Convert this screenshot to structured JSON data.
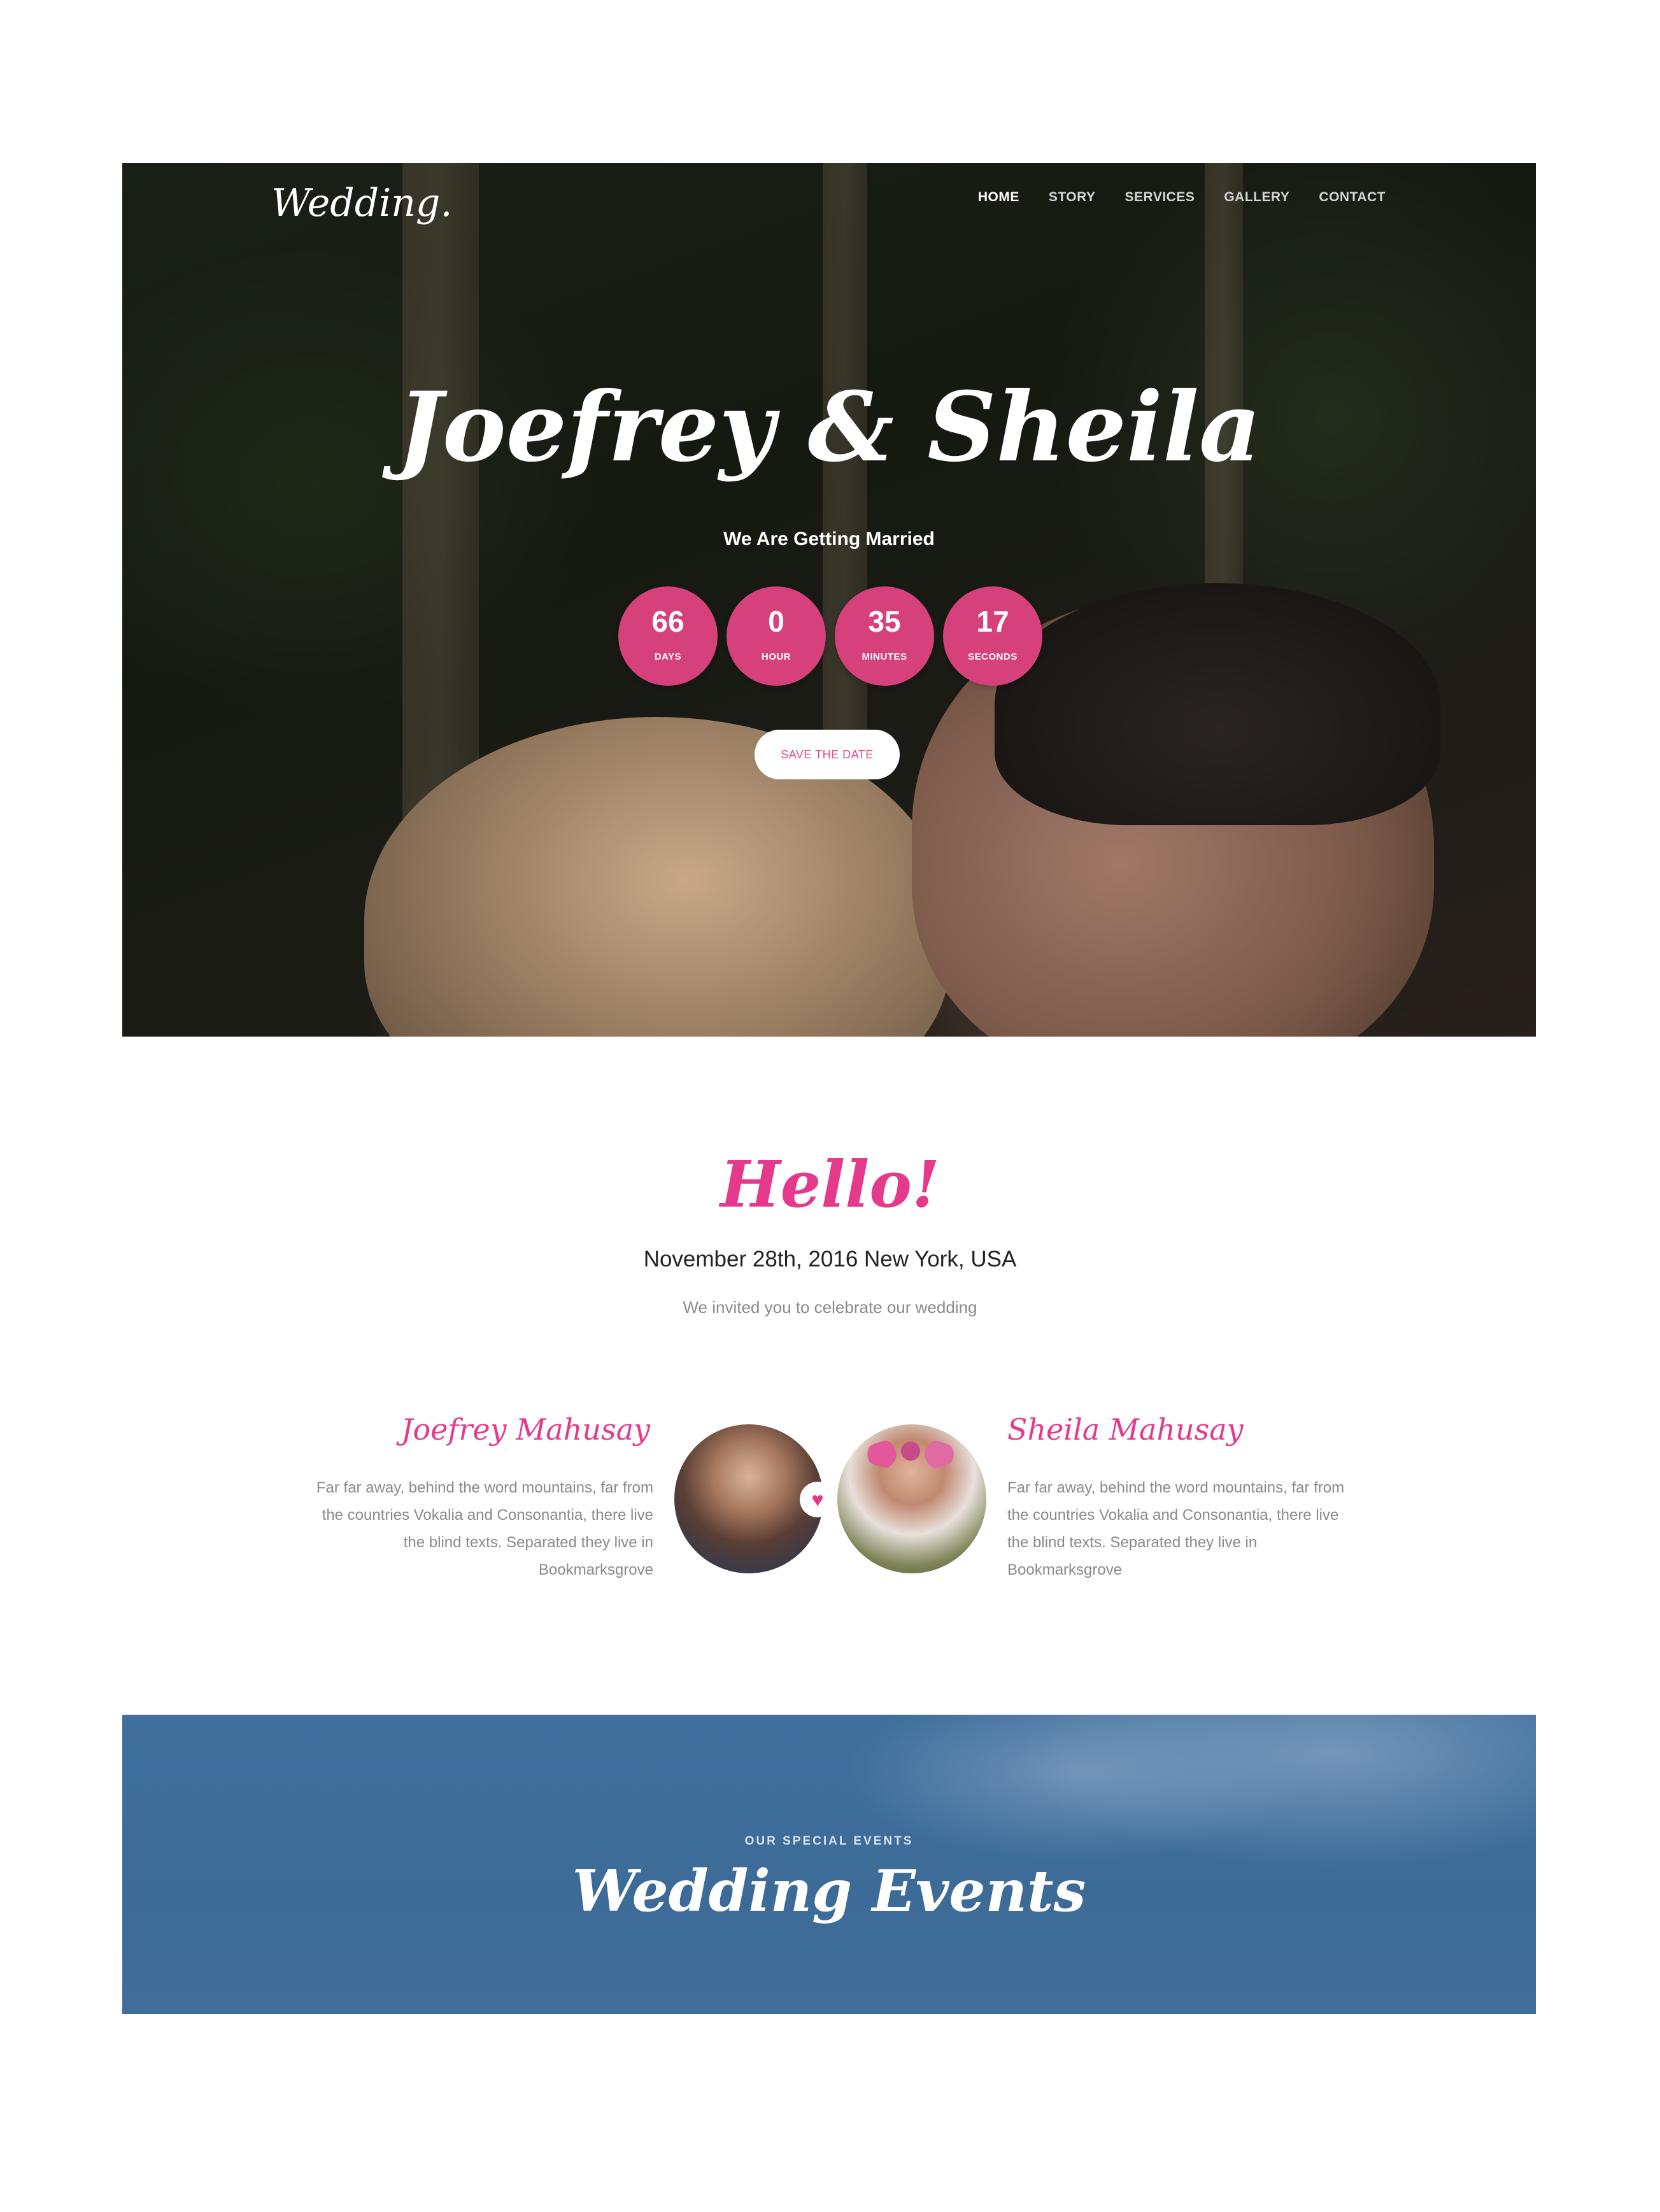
{
  "brand": {
    "logo": "Wedding."
  },
  "nav": {
    "items": [
      "HOME",
      "STORY",
      "SERVICES",
      "GALLERY",
      "CONTACT"
    ]
  },
  "hero": {
    "title": "Joefrey & Sheila",
    "tagline": "We Are Getting Married",
    "countdown": [
      {
        "value": "66",
        "label": "DAYS"
      },
      {
        "value": "0",
        "label": "HOUR"
      },
      {
        "value": "35",
        "label": "MINUTES"
      },
      {
        "value": "17",
        "label": "SECONDS"
      }
    ],
    "cta": "SAVE THE DATE"
  },
  "hello": {
    "title": "Hello!",
    "date": "November 28th, 2016 New York, USA",
    "invite": "We invited you to celebrate our wedding"
  },
  "couple": {
    "groom": {
      "name": "Joefrey Mahusay",
      "bio": "Far far away, behind the word mountains, far from the countries Vokalia and Consonantia, there live the blind texts. Separated they live in Bookmarksgrove"
    },
    "bride": {
      "name": "Sheila Mahusay",
      "bio": "Far far away, behind the word mountains, far from the countries Vokalia and Consonantia, there live the blind texts. Separated they live in Bookmarksgrove"
    },
    "heart_icon": "heart-icon"
  },
  "events": {
    "kicker": "OUR SPECIAL EVENTS",
    "title": "Wedding Events"
  },
  "colors": {
    "accent": "#e5398b",
    "countdown_bg": "#d6417c",
    "events_bg": "#3f6f9c"
  }
}
